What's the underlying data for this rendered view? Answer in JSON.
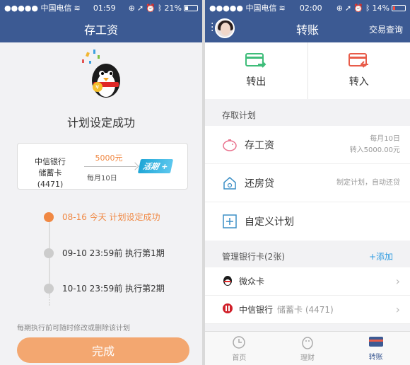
{
  "left": {
    "status": {
      "carrier": "●●●●● 中国电信",
      "time": "01:59",
      "battery": "21%"
    },
    "nav_title": "存工资",
    "success_title": "计划设定成功",
    "plan_card": {
      "bank": "中信银行",
      "card": "储蓄卡(4471)",
      "amount": "5000元",
      "frequency": "每月10日",
      "badge": "活期 +"
    },
    "timeline": [
      {
        "date": "08-16 今天",
        "text": "计划设定成功"
      },
      {
        "date": "09-10 23:59前",
        "text": "执行第1期"
      },
      {
        "date": "10-10 23:59前",
        "text": "执行第2期"
      }
    ],
    "note": "每期执行前可随时修改或删除该计划",
    "done_button": "完成"
  },
  "right": {
    "status": {
      "carrier": "●●●●● 中国电信",
      "time": "02:00",
      "battery": "14%"
    },
    "nav_title": "转账",
    "nav_link": "交易查询",
    "transfer_out": "转出",
    "transfer_in": "转入",
    "plan_section_title": "存取计划",
    "plans": [
      {
        "label": "存工资",
        "meta1": "每月10日",
        "meta2": "转入5000.00元"
      },
      {
        "label": "还房贷",
        "meta1": "制定计划，自动还贷",
        "meta2": ""
      },
      {
        "label": "自定义计划",
        "meta1": "",
        "meta2": ""
      }
    ],
    "cards_section_title": "管理银行卡(2张)",
    "add_link": "+添加",
    "cards": [
      {
        "name": "微众卡",
        "sub": ""
      },
      {
        "name": "中信银行",
        "sub": "储蓄卡 (4471)"
      }
    ],
    "tabs": [
      {
        "label": "首页"
      },
      {
        "label": "理财"
      },
      {
        "label": "转账"
      }
    ]
  },
  "colors": {
    "nav": "#3c5a93",
    "accent": "#f08843",
    "link": "#2f9be0"
  }
}
